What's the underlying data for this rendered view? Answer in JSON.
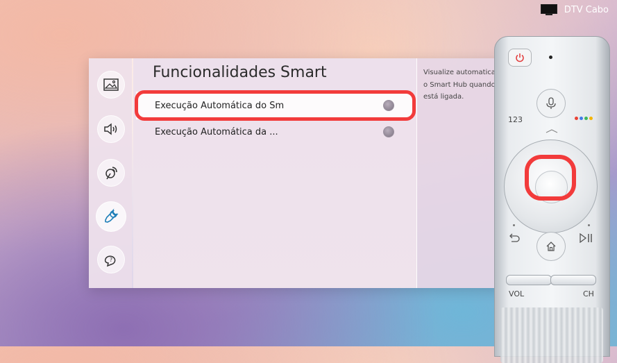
{
  "status": {
    "source_label": "DTV Cabo"
  },
  "sidebar": {
    "items": [
      {
        "icon": "picture-icon"
      },
      {
        "icon": "sound-icon"
      },
      {
        "icon": "broadcast-icon"
      },
      {
        "icon": "wrench-icon",
        "active": true
      },
      {
        "icon": "support-icon"
      }
    ]
  },
  "main": {
    "title": "Funcionalidades Smart",
    "items": [
      {
        "label": "Execução Automática do Sm",
        "focused": true
      },
      {
        "label": "Execução Automática da ..."
      }
    ]
  },
  "description": {
    "lines": [
      "Visualize automatica",
      "o Smart Hub quando",
      "está ligada."
    ]
  },
  "remote": {
    "number_label": "123",
    "vol_label": "VOL",
    "ch_label": "CH",
    "color_dots": [
      "#e94235",
      "#3f7be8",
      "#3fb55c",
      "#f5b400"
    ]
  },
  "colors": {
    "highlight": "#f23b3b"
  }
}
